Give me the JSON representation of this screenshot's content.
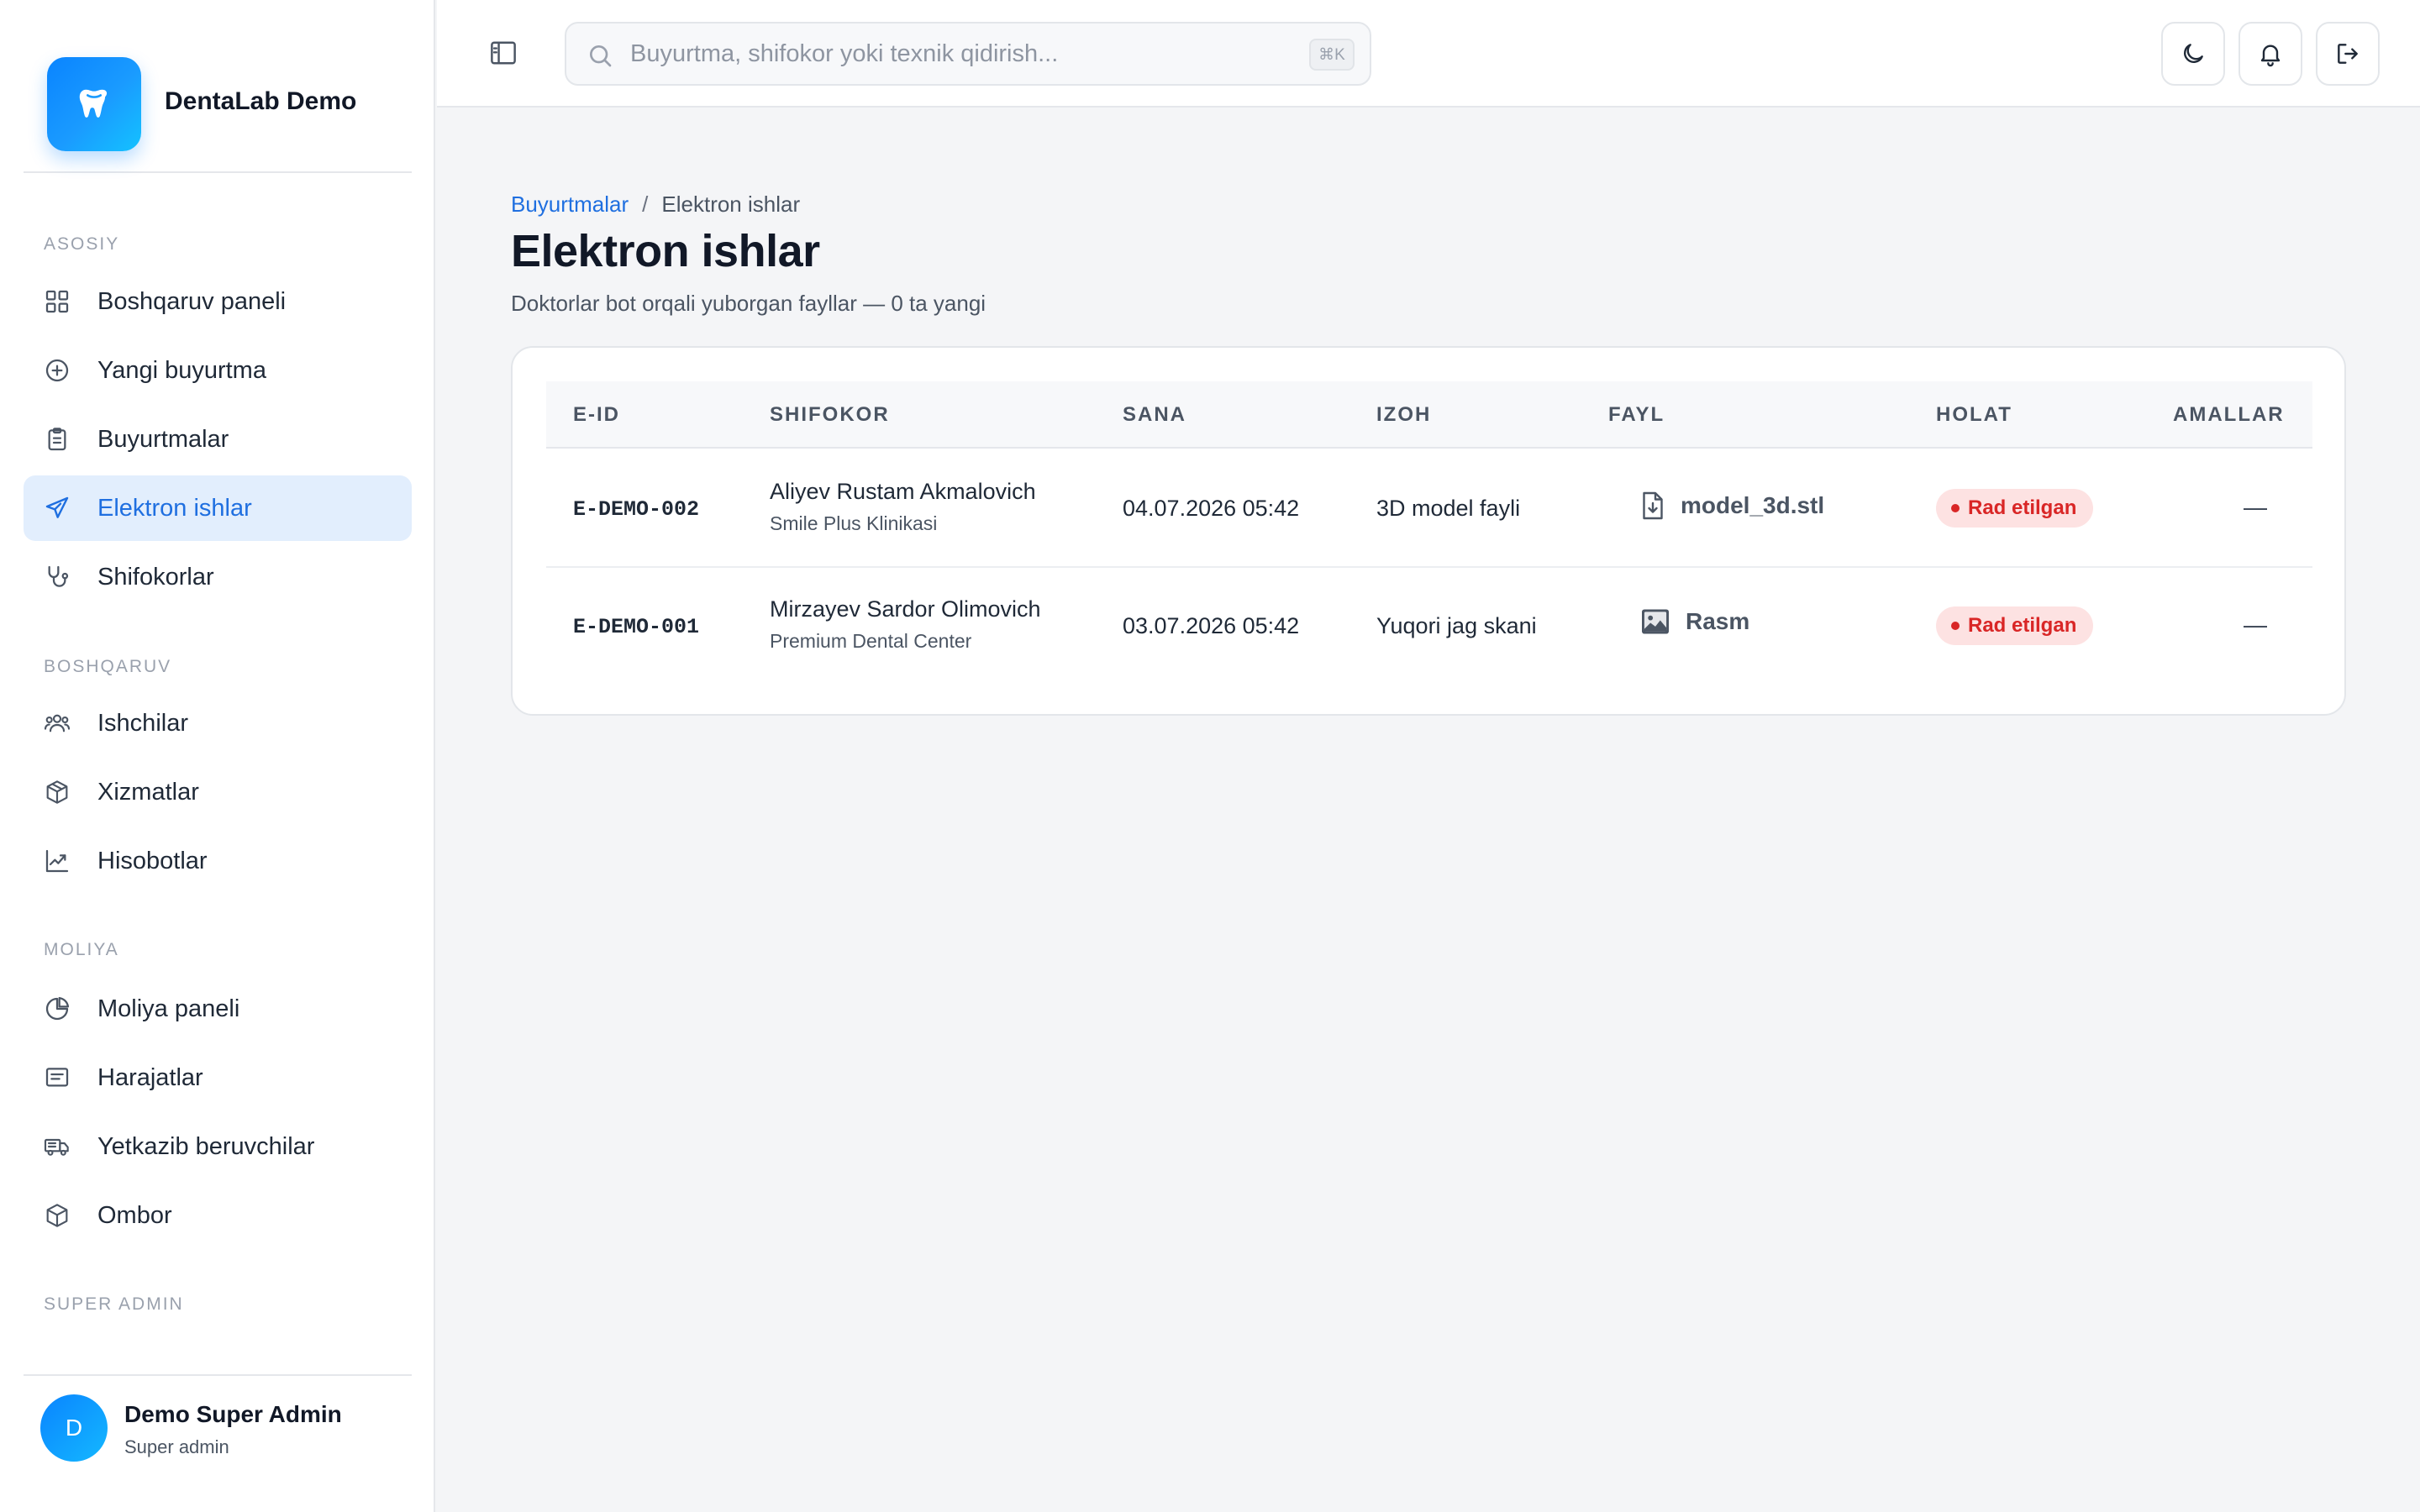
{
  "brand": {
    "name": "DentaLab Demo",
    "logo_icon": "tooth-icon",
    "accent": "#0a84ff"
  },
  "sidebar": {
    "sections": [
      {
        "label": "ASOSIY"
      },
      {
        "label": "BOSHQARUV"
      },
      {
        "label": "MOLIYA"
      },
      {
        "label": "SUPER ADMIN"
      }
    ],
    "items": [
      {
        "label": "Boshqaruv paneli",
        "icon": "grid-icon"
      },
      {
        "label": "Yangi buyurtma",
        "icon": "plus-circle-icon"
      },
      {
        "label": "Buyurtmalar",
        "icon": "clipboard-icon"
      },
      {
        "label": "Elektron ishlar",
        "icon": "send-icon",
        "active": true
      },
      {
        "label": "Shifokorlar",
        "icon": "stethoscope-icon"
      },
      {
        "label": "Ishchilar",
        "icon": "users-icon"
      },
      {
        "label": "Xizmatlar",
        "icon": "box-icon"
      },
      {
        "label": "Hisobotlar",
        "icon": "chart-line-icon"
      },
      {
        "label": "Moliya paneli",
        "icon": "pie-chart-icon"
      },
      {
        "label": "Harajatlar",
        "icon": "receipt-icon"
      },
      {
        "label": "Yetkazib beruvchilar",
        "icon": "truck-icon"
      },
      {
        "label": "Ombor",
        "icon": "package-icon"
      }
    ]
  },
  "user": {
    "initial": "D",
    "name": "Demo Super Admin",
    "role": "Super admin"
  },
  "topbar": {
    "search_placeholder": "Buyurtma, shifokor yoki texnik qidirish...",
    "search_value": "",
    "shortcut": "⌘K",
    "actions": [
      "moon-icon",
      "bell-icon",
      "logout-icon"
    ]
  },
  "page": {
    "breadcrumb": {
      "parent": "Buyurtmalar",
      "separator": "/",
      "current": "Elektron ishlar"
    },
    "title": "Elektron ishlar",
    "subtitle": "Doktorlar bot orqali yuborgan fayllar — 0 ta yangi"
  },
  "table": {
    "columns": [
      "E-ID",
      "SHIFOKOR",
      "SANA",
      "IZOH",
      "FAYL",
      "HOLAT",
      "AMALLAR"
    ],
    "rows": [
      {
        "eid": "E-DEMO-002",
        "doctor": "Aliyev Rustam Akmalovich",
        "clinic": "Smile Plus Klinikasi",
        "date": "04.07.2026 05:42",
        "note": "3D model fayli",
        "file": "model_3d.stl",
        "file_icon": "file-download-icon",
        "status": "Rad etilgan",
        "actions": "—"
      },
      {
        "eid": "E-DEMO-001",
        "doctor": "Mirzayev Sardor Olimovich",
        "clinic": "Premium Dental Center",
        "date": "03.07.2026 05:42",
        "note": "Yuqori jag skani",
        "file": "Rasm",
        "file_icon": "image-icon",
        "status": "Rad etilgan",
        "actions": "—"
      }
    ]
  },
  "colors": {
    "active_bg": "#e2eefd",
    "active_text": "#1f6fe0",
    "danger": "#d92626",
    "danger_bg": "#fde2e2"
  }
}
